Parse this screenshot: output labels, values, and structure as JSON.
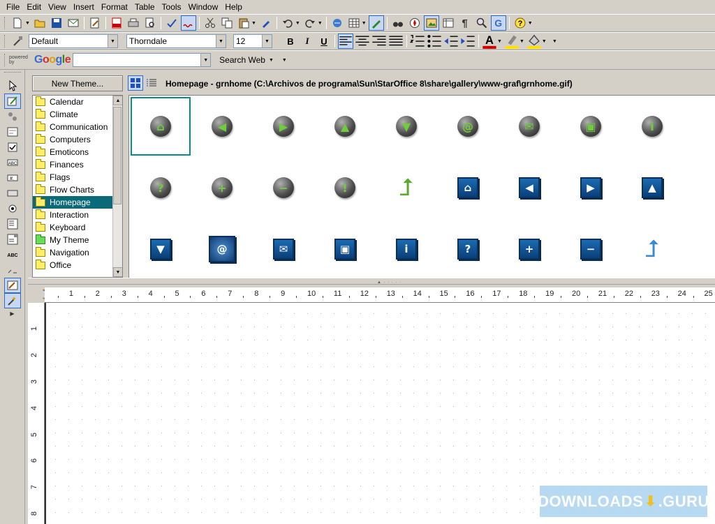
{
  "menu": [
    "File",
    "Edit",
    "View",
    "Insert",
    "Format",
    "Table",
    "Tools",
    "Window",
    "Help"
  ],
  "formatting": {
    "paragraph_style": "Default",
    "font_name": "Thorndale",
    "font_size": "12",
    "bold": "B",
    "italic": "I",
    "underline": "U"
  },
  "google_bar": {
    "powered_by": "powered by",
    "logo": "Google",
    "search_value": "",
    "search_button": "Search Web"
  },
  "gallery": {
    "new_theme_button": "New Theme...",
    "path": "Homepage - grnhome (C:\\Archivos de programa\\Sun\\StarOffice 8\\share\\gallery\\www-graf\\grnhome.gif)",
    "themes": [
      {
        "label": "Calendar",
        "color": "yellow"
      },
      {
        "label": "Climate",
        "color": "yellow"
      },
      {
        "label": "Communication",
        "color": "yellow"
      },
      {
        "label": "Computers",
        "color": "yellow"
      },
      {
        "label": "Emoticons",
        "color": "yellow"
      },
      {
        "label": "Finances",
        "color": "yellow"
      },
      {
        "label": "Flags",
        "color": "yellow"
      },
      {
        "label": "Flow Charts",
        "color": "yellow"
      },
      {
        "label": "Homepage",
        "color": "yellow",
        "selected": true
      },
      {
        "label": "Interaction",
        "color": "yellow"
      },
      {
        "label": "Keyboard",
        "color": "yellow"
      },
      {
        "label": "My Theme",
        "color": "green"
      },
      {
        "label": "Navigation",
        "color": "yellow"
      },
      {
        "label": "Office",
        "color": "yellow"
      }
    ],
    "items": [
      {
        "name": "grnhome",
        "style": "orb",
        "symbol": "⌂",
        "selected": true
      },
      {
        "name": "green-left",
        "style": "orb",
        "symbol": "◀"
      },
      {
        "name": "green-right",
        "style": "orb",
        "symbol": "▶"
      },
      {
        "name": "green-up",
        "style": "orb",
        "symbol": "▲"
      },
      {
        "name": "green-down",
        "style": "orb",
        "symbol": "▼"
      },
      {
        "name": "green-at",
        "style": "orb",
        "symbol": "@"
      },
      {
        "name": "green-mail",
        "style": "orb",
        "symbol": "✉"
      },
      {
        "name": "green-save",
        "style": "orb",
        "symbol": "▣"
      },
      {
        "name": "green-info",
        "style": "orb",
        "symbol": "i"
      },
      {
        "name": "green-question",
        "style": "orb",
        "symbol": "?"
      },
      {
        "name": "green-plus",
        "style": "orb",
        "symbol": "+"
      },
      {
        "name": "green-minus",
        "style": "orb",
        "symbol": "−"
      },
      {
        "name": "green-exclaim",
        "style": "orb",
        "symbol": "!"
      },
      {
        "name": "green-up-arrow",
        "style": "arrow",
        "symbol": "⮥"
      },
      {
        "name": "blue-home",
        "style": "square",
        "symbol": "⌂"
      },
      {
        "name": "blue-left",
        "style": "square",
        "symbol": "◀"
      },
      {
        "name": "blue-right",
        "style": "square",
        "symbol": "▶"
      },
      {
        "name": "blue-up",
        "style": "square",
        "symbol": "▲"
      },
      {
        "name": "blue-down",
        "style": "square",
        "symbol": "▼"
      },
      {
        "name": "blue-at",
        "style": "square-big",
        "symbol": "@"
      },
      {
        "name": "blue-mail",
        "style": "square",
        "symbol": "✉"
      },
      {
        "name": "blue-save",
        "style": "square",
        "symbol": "▣"
      },
      {
        "name": "blue-info",
        "style": "square",
        "symbol": "i"
      },
      {
        "name": "blue-question",
        "style": "square",
        "symbol": "?"
      },
      {
        "name": "blue-plus",
        "style": "square",
        "symbol": "+"
      },
      {
        "name": "blue-minus",
        "style": "square",
        "symbol": "−"
      },
      {
        "name": "blue-up-arrow",
        "style": "blue-arrow",
        "symbol": "⮥"
      }
    ]
  },
  "ruler": {
    "h_labels": [
      "1",
      "2",
      "3",
      "4",
      "5",
      "6",
      "7",
      "8",
      "9",
      "10",
      "11",
      "12",
      "13",
      "14",
      "15",
      "16",
      "17",
      "18",
      "19",
      "20",
      "21",
      "22",
      "23",
      "24",
      "25"
    ],
    "v_labels": [
      "1",
      "2",
      "3",
      "4",
      "5",
      "6",
      "7",
      "8"
    ]
  },
  "watermark": {
    "left": "DOWNLOADS",
    "right": ".GURU"
  },
  "colors": {
    "selection": "#0a6a7a",
    "orb_symbol": "#6fcc3a",
    "tile_blue": "#1b6ab0"
  }
}
